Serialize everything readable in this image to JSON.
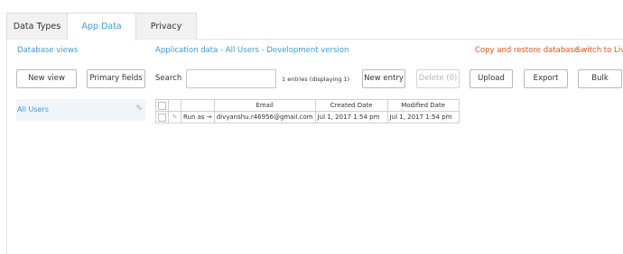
{
  "tabs": [
    {
      "label": "Data Types",
      "active": false
    },
    {
      "label": "App Data",
      "active": true
    },
    {
      "label": "Privacy",
      "active": false
    }
  ],
  "sidebar": {
    "heading": "Database views",
    "new_view_label": "New view",
    "primary_fields_label": "Primary fields",
    "views": [
      {
        "label": "All Users",
        "selected": true
      }
    ]
  },
  "main": {
    "title": "Application data - All Users - Development version",
    "copy_restore_label": "Copy and restore database",
    "switch_live_label": "Switch to Live",
    "search_label": "Search",
    "search_value": "",
    "entries_text": "1 entries (displaying 1)",
    "new_entry_label": "New entry",
    "delete_label": "Delete (0)",
    "upload_label": "Upload",
    "export_label": "Export",
    "bulk_label": "Bulk"
  },
  "table": {
    "columns": [
      "Email",
      "Created Date",
      "Modified Date"
    ],
    "rows": [
      {
        "run_as": "Run as →",
        "email": "divyanshu.r46956@gmail.com",
        "created": "Jul 1, 2017 1:54 pm",
        "modified": "Jul 1, 2017 1:54 pm"
      }
    ]
  },
  "colors": {
    "accent": "#3e9bd3",
    "warning": "#e0541c"
  }
}
